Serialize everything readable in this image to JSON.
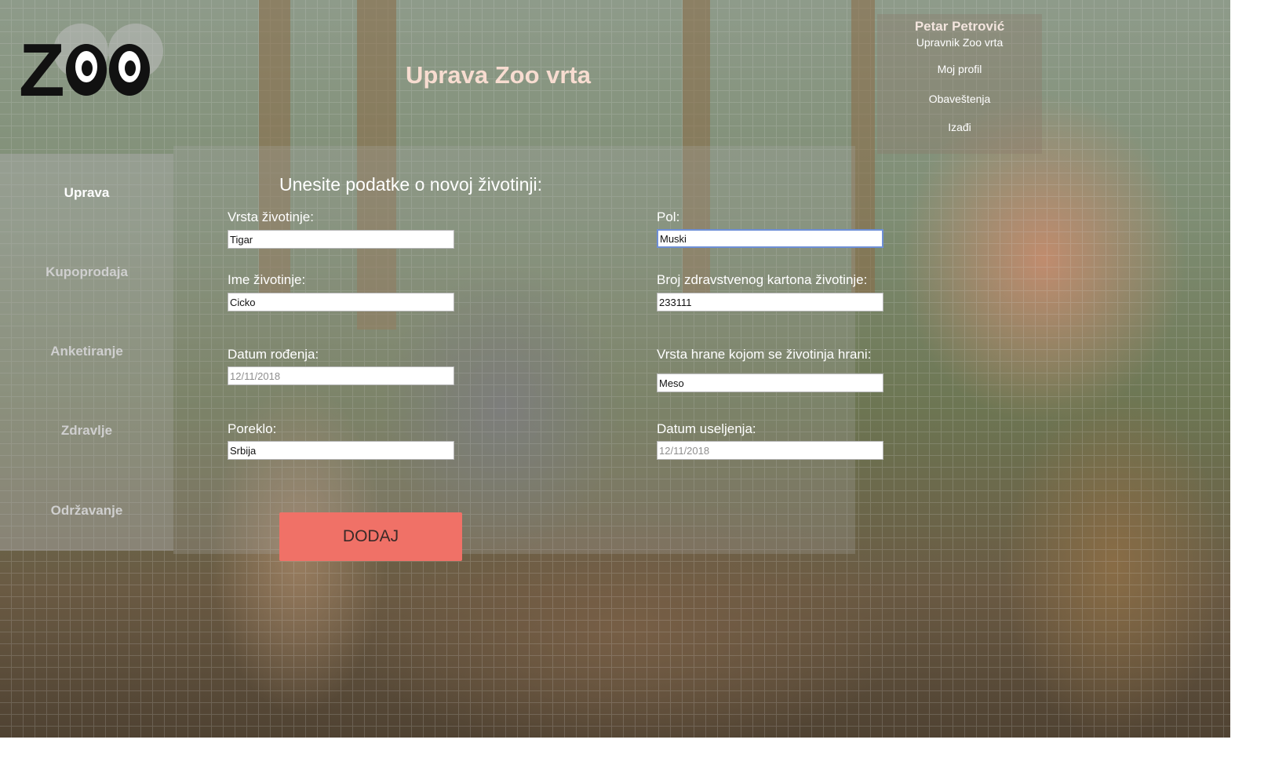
{
  "header": {
    "title": "Uprava Zoo vrta",
    "logo_text": "Z"
  },
  "user": {
    "name": "Petar Petrović",
    "role": "Upravnik Zoo vrta",
    "links": [
      "Moj profil",
      "Obaveštenja",
      "Izađi"
    ]
  },
  "sidebar": {
    "items": [
      {
        "label": "Uprava",
        "active": true
      },
      {
        "label": "Kupoprodaja",
        "active": false
      },
      {
        "label": "Anketiranje",
        "active": false
      },
      {
        "label": "Zdravlje",
        "active": false
      },
      {
        "label": "Održavanje",
        "active": false
      }
    ]
  },
  "form": {
    "heading": "Unesite podatke o novoj životinji:",
    "fields": {
      "species": {
        "label": "Vrsta životinje:",
        "value": "Tigar"
      },
      "gender": {
        "label": "Pol:",
        "value": "Muski"
      },
      "name": {
        "label": "Ime životinje:",
        "value": "Cicko"
      },
      "health_card": {
        "label": "Broj zdravstvenog kartona životinje:",
        "value": "233111"
      },
      "birth_date": {
        "label": "Datum rođenja:",
        "value": "",
        "placeholder": "12/11/2018"
      },
      "food": {
        "label": "Vrsta hrane kojom se životinja hrani:",
        "value": "Meso"
      },
      "origin": {
        "label": "Poreklo:",
        "value": "Srbija"
      },
      "move_in_date": {
        "label": "Datum useljenja:",
        "value": "",
        "placeholder": "12/11/2018"
      }
    },
    "submit_label": "DODAJ"
  },
  "colors": {
    "title": "#f7dcd0",
    "button": "#f07167",
    "focus_border": "#6e8fd6"
  }
}
